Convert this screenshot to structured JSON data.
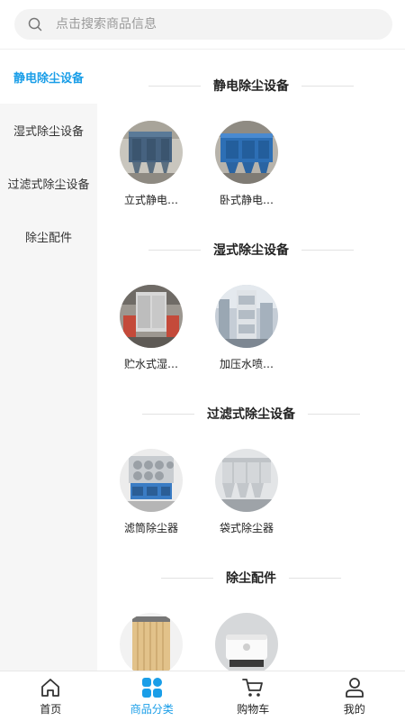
{
  "search": {
    "placeholder": "点击搜索商品信息",
    "icon": "search-icon"
  },
  "sidebar": {
    "items": [
      {
        "label": "静电除尘设备",
        "active": true
      },
      {
        "label": "湿式除尘设备",
        "active": false
      },
      {
        "label": "过滤式除尘设备",
        "active": false
      },
      {
        "label": "除尘配件",
        "active": false
      }
    ]
  },
  "sections": [
    {
      "title": "静电除尘设备",
      "items": [
        {
          "label": "立式静电…"
        },
        {
          "label": "卧式静电…"
        }
      ]
    },
    {
      "title": "湿式除尘设备",
      "items": [
        {
          "label": "贮水式湿…"
        },
        {
          "label": "加压水喷…"
        }
      ]
    },
    {
      "title": "过滤式除尘设备",
      "items": [
        {
          "label": "滤筒除尘器"
        },
        {
          "label": "袋式除尘器"
        }
      ]
    },
    {
      "title": "除尘配件",
      "items": [
        {
          "label": ""
        },
        {
          "label": ""
        }
      ]
    }
  ],
  "tabbar": {
    "tabs": [
      {
        "label": "首页",
        "icon": "home-icon"
      },
      {
        "label": "商品分类",
        "icon": "category-icon",
        "active": true
      },
      {
        "label": "购物车",
        "icon": "cart-icon"
      },
      {
        "label": "我的",
        "icon": "user-icon"
      }
    ]
  },
  "colors": {
    "accent": "#1a9ee8",
    "sidebar_bg": "#f6f6f6",
    "search_bg": "#f3f3f3"
  }
}
